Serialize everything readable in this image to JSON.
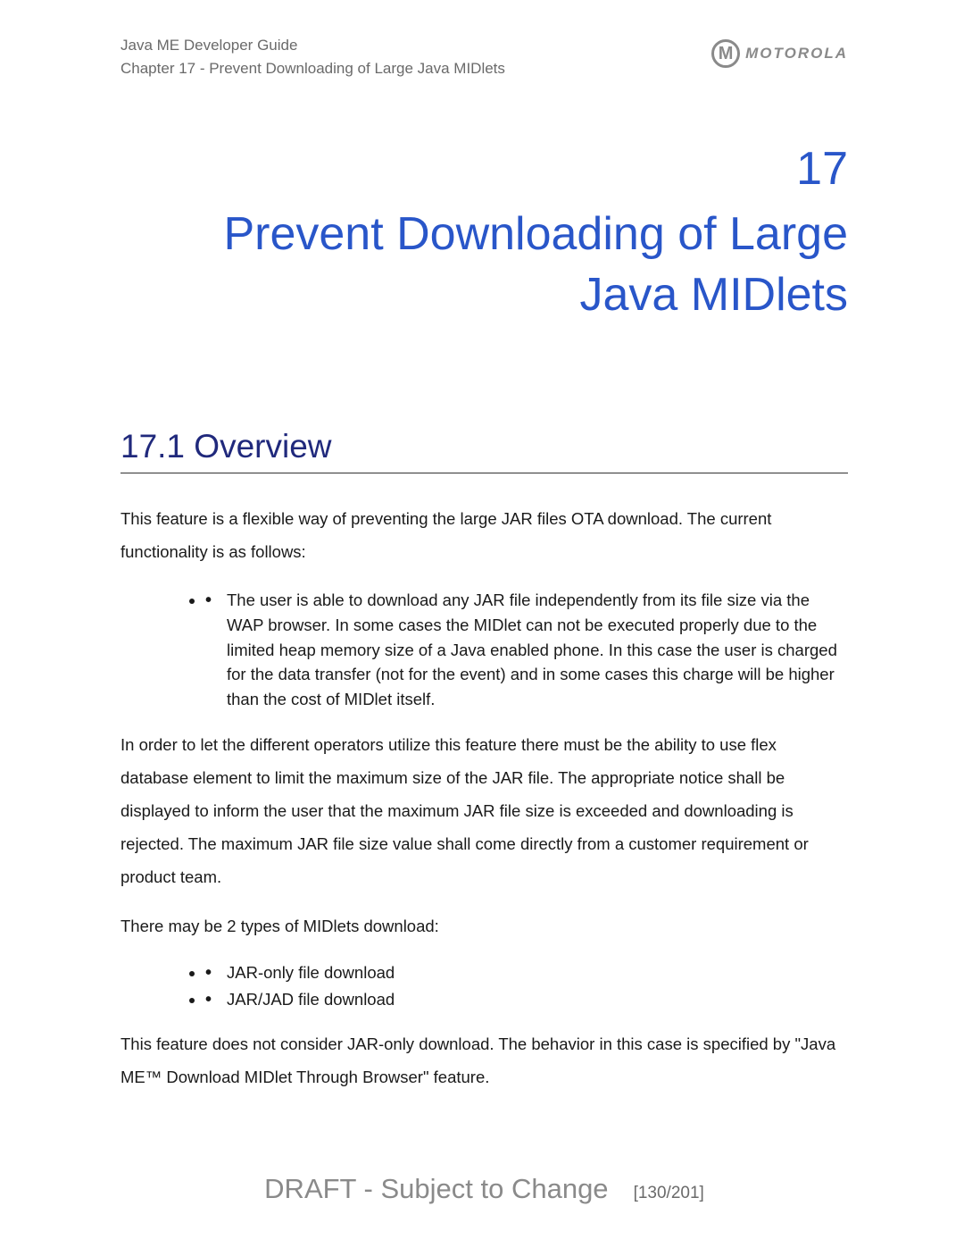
{
  "header": {
    "guide_title": "Java ME Developer Guide",
    "chapter_line": "Chapter 17 - Prevent Downloading of Large Java MIDlets",
    "logo_text": "MOTOROLA"
  },
  "chapter": {
    "number": "17",
    "title": "Prevent Downloading of Large Java MIDlets"
  },
  "section": {
    "heading": "17.1 Overview",
    "intro": "This feature is a flexible way of preventing the large JAR files OTA download. The current functionality is as follows:",
    "bullet1": "The user is able to download any JAR file independently from its file size via the WAP browser. In some cases the MIDlet can not be executed properly due to the limited heap memory size of a Java enabled phone. In this case the user is charged for the data transfer (not for the event) and in some cases this charge will be higher than the cost of MIDlet itself.",
    "para2": "In order to let the different operators utilize this feature there must be the ability to use flex database element to limit the maximum size of the JAR file. The appropriate notice shall be displayed to inform the user that the maximum JAR file size is exceeded and downloading is rejected. The maximum JAR file size value shall come directly from a customer requirement or product team.",
    "para3": "There may be 2 types of MIDlets download:",
    "bullet_a": "JAR-only file download",
    "bullet_b": "JAR/JAD file download",
    "para4": "This feature does not consider JAR-only download. The behavior in this case is specified by \"Java ME™ Download MIDlet Through Browser\" feature."
  },
  "footer": {
    "draft": "DRAFT - Subject to Change",
    "page": "[130/201]"
  }
}
